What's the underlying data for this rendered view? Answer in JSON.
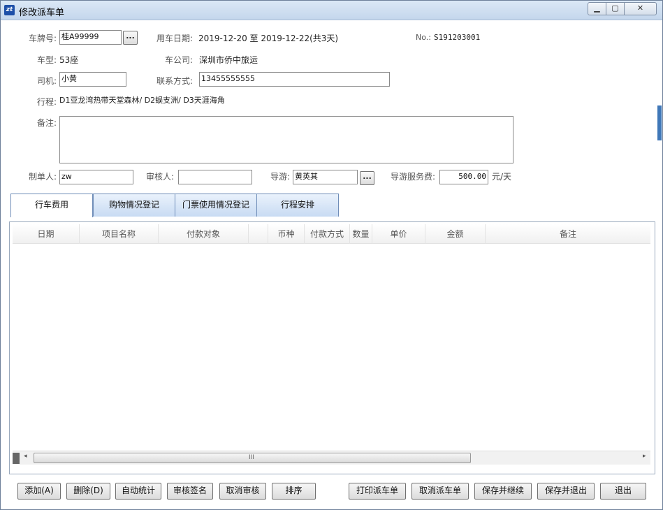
{
  "window": {
    "title": "修改派车单",
    "app_icon": "zt",
    "controls": {
      "minimize": "▁",
      "maximize": "▢",
      "close": "✕"
    }
  },
  "form": {
    "plate_label": "车牌号:",
    "plate_value": "桂A99999",
    "use_date_label": "用车日期:",
    "use_date_value": "2019-12-20 至 2019-12-22(共3天)",
    "no_label": "No.:",
    "no_value": "S191203001",
    "car_type_label": "车型:",
    "car_type_value": "53座",
    "company_label": "车公司:",
    "company_value": "深圳市侨中旅运",
    "driver_label": "司机:",
    "driver_value": "小黄",
    "contact_label": "联系方式:",
    "contact_value": "13455555555",
    "route_label": "行程:",
    "route_value": "D1亚龙湾热带天堂森林/ D2蜈支洲/ D3天涯海角",
    "remark_label": "备注:",
    "remark_value": "",
    "maker_label": "制单人:",
    "maker_value": "zw",
    "reviewer_label": "审核人:",
    "reviewer_value": "",
    "guide_label": "导游:",
    "guide_value": "黄英其",
    "guide_fee_label": "导游服务费:",
    "guide_fee_value": "500.00",
    "guide_fee_unit": "元/天",
    "browse_label": "..."
  },
  "tabs": [
    {
      "label": "行车费用",
      "active": true
    },
    {
      "label": "购物情况登记",
      "active": false
    },
    {
      "label": "门票使用情况登记",
      "active": false
    },
    {
      "label": "行程安排",
      "active": false
    }
  ],
  "grid": {
    "columns": [
      "日期",
      "项目名称",
      "付款对象",
      "",
      "币种",
      "付款方式",
      "数量",
      "单价",
      "金额",
      "备注"
    ],
    "rows": [],
    "scroll_grip": "III",
    "scroll_left": "◂",
    "scroll_right": "▸"
  },
  "buttons": {
    "add": "添加(A)",
    "delete": "删除(D)",
    "auto_stat": "自动统计",
    "review_sign": "审核签名",
    "cancel_review": "取消审核",
    "sort": "排序",
    "print": "打印派车单",
    "cancel_dispatch": "取消派车单",
    "save_continue": "保存并继续",
    "save_exit": "保存并退出",
    "exit": "退出"
  }
}
